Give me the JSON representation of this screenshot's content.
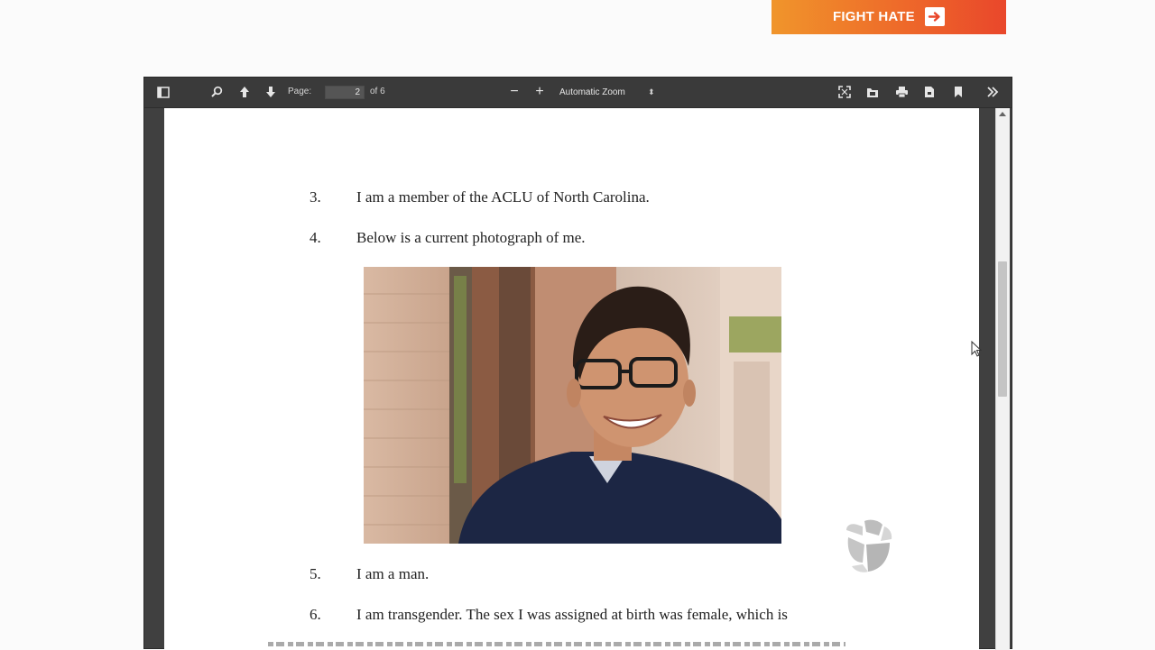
{
  "banner": {
    "label": "FIGHT HATE",
    "arrow_icon": "arrow-right-icon",
    "colors": [
      "#f0952b",
      "#e9472b"
    ]
  },
  "toolbar": {
    "sidebar_icon": "sidebar-toggle-icon",
    "find_icon": "search-icon",
    "prev_icon": "arrow-up-icon",
    "next_icon": "arrow-down-icon",
    "page_label": "Page:",
    "page_value": "2",
    "page_count": "of 6",
    "zoom_out": "−",
    "zoom_in": "+",
    "zoom_value": "Automatic Zoom",
    "right_icons": [
      "fullscreen-icon",
      "open-file-icon",
      "print-icon",
      "download-icon",
      "bookmark-icon",
      "more-tools-icon"
    ]
  },
  "document": {
    "paragraphs": [
      {
        "num": "3.",
        "text": "I am a member of the ACLU of North Carolina."
      },
      {
        "num": "4.",
        "text": "Below is a current photograph of me."
      },
      {
        "num": "5.",
        "text": "I am a man."
      },
      {
        "num": "6.",
        "text": "I am transgender.   The sex I was assigned at birth was female, which is"
      }
    ]
  },
  "watermark": {
    "icon": "univision-logo-icon"
  }
}
